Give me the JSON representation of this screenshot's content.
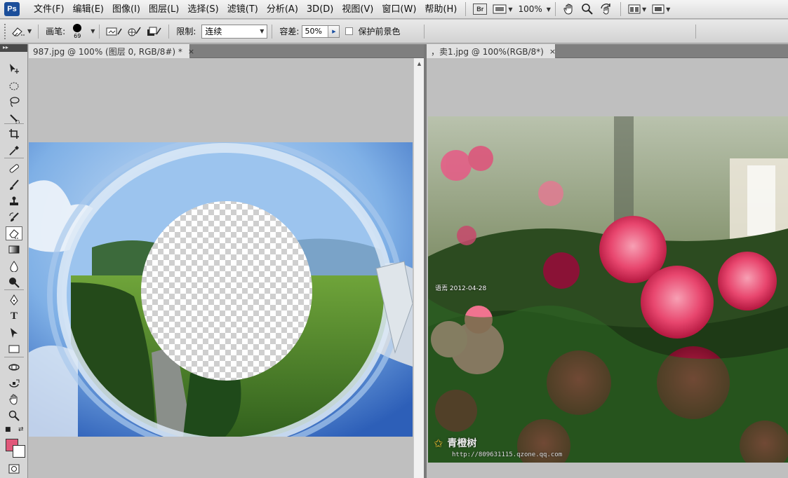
{
  "app": {
    "logo": "Ps",
    "menu": [
      "文件(F)",
      "编辑(E)",
      "图像(I)",
      "图层(L)",
      "选择(S)",
      "滤镜(T)",
      "分析(A)",
      "3D(D)",
      "视图(V)",
      "窗口(W)",
      "帮助(H)"
    ],
    "bridge_label": "Br",
    "zoom": "100%"
  },
  "options": {
    "brush_label": "画笔:",
    "brush_size": "69",
    "limit_label": "限制:",
    "limit_value": "连续",
    "tolerance_label": "容差:",
    "tolerance_value": "50%",
    "protect_fg_label": "保护前景色"
  },
  "tools": [
    "move-tool",
    "elliptical-marquee-tool",
    "lasso-tool",
    "quick-selection-tool",
    "crop-tool",
    "eyedropper-tool",
    "spot-healing-brush-tool",
    "brush-tool",
    "clone-stamp-tool",
    "history-brush-tool",
    "background-eraser-tool",
    "gradient-tool",
    "blur-tool",
    "dodge-tool",
    "pen-tool",
    "type-tool",
    "path-selection-tool",
    "rectangle-tool",
    "3d-rotate-tool",
    "3d-orbit-tool",
    "hand-tool",
    "zoom-tool"
  ],
  "type_tool_glyph": "T",
  "colors": {
    "foreground": "#e0587a",
    "background": "#ffffff",
    "accent": "#1b4e9a"
  },
  "documents": [
    {
      "tab_title": "987.jpg @ 100% (图层 0, RGB/8#) *",
      "close": "×"
    },
    {
      "tab_title": "，卖1.jpg @ 100%(RGB/8*)",
      "close": "×"
    }
  ],
  "photo_right": {
    "date_text": "语焉 2012-04-28",
    "brand_text": "青橙树",
    "url_text": "http://809631115.qzone.qq.com"
  }
}
